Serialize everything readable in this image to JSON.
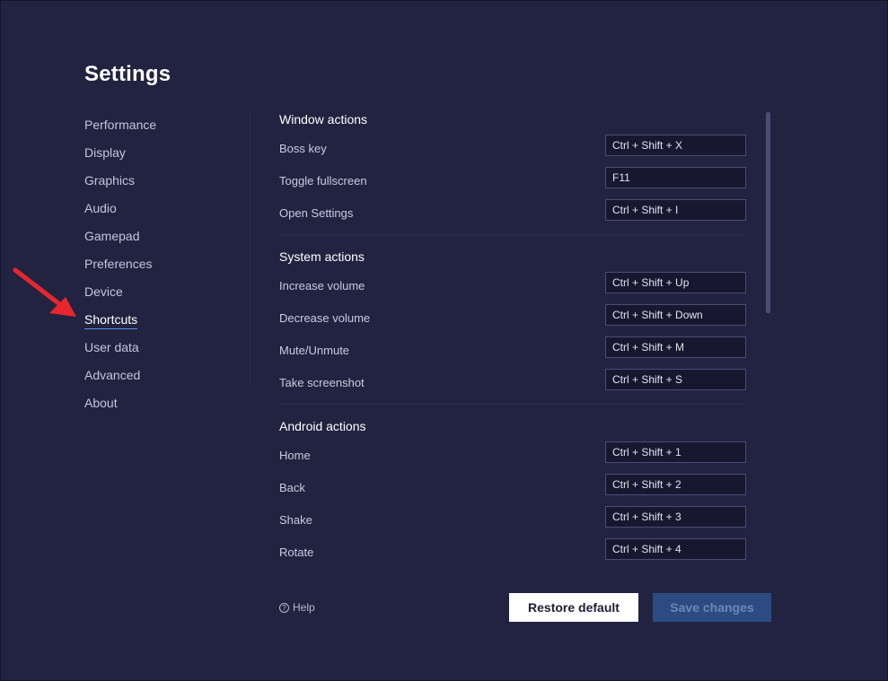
{
  "title": "Settings",
  "nav": [
    {
      "label": "Performance",
      "name": "nav-performance"
    },
    {
      "label": "Display",
      "name": "nav-display"
    },
    {
      "label": "Graphics",
      "name": "nav-graphics"
    },
    {
      "label": "Audio",
      "name": "nav-audio"
    },
    {
      "label": "Gamepad",
      "name": "nav-gamepad"
    },
    {
      "label": "Preferences",
      "name": "nav-preferences"
    },
    {
      "label": "Device",
      "name": "nav-device"
    },
    {
      "label": "Shortcuts",
      "name": "nav-shortcuts",
      "active": true
    },
    {
      "label": "User data",
      "name": "nav-user-data"
    },
    {
      "label": "Advanced",
      "name": "nav-advanced"
    },
    {
      "label": "About",
      "name": "nav-about"
    }
  ],
  "sections": [
    {
      "title": "Window actions",
      "rows": [
        {
          "label": "Boss key",
          "key": "Ctrl + Shift + X"
        },
        {
          "label": "Toggle fullscreen",
          "key": "F11"
        },
        {
          "label": "Open Settings",
          "key": "Ctrl + Shift + I"
        }
      ]
    },
    {
      "title": "System actions",
      "rows": [
        {
          "label": "Increase volume",
          "key": "Ctrl + Shift + Up"
        },
        {
          "label": "Decrease volume",
          "key": "Ctrl + Shift + Down"
        },
        {
          "label": "Mute/Unmute",
          "key": "Ctrl + Shift + M"
        },
        {
          "label": "Take screenshot",
          "key": "Ctrl + Shift + S"
        }
      ]
    },
    {
      "title": "Android actions",
      "rows": [
        {
          "label": "Home",
          "key": "Ctrl + Shift + 1"
        },
        {
          "label": "Back",
          "key": "Ctrl + Shift + 2"
        },
        {
          "label": "Shake",
          "key": "Ctrl + Shift + 3"
        },
        {
          "label": "Rotate",
          "key": "Ctrl + Shift + 4"
        }
      ]
    }
  ],
  "footer": {
    "help_icon": "question-circle-icon",
    "help_label": "Help",
    "restore_label": "Restore default",
    "save_label": "Save changes"
  },
  "annotation": {
    "icon": "red-arrow-icon",
    "color": "#e8262d"
  },
  "colors": {
    "accent": "#5c8ef0",
    "background": "#222340",
    "save_button": "#2d4b83"
  }
}
